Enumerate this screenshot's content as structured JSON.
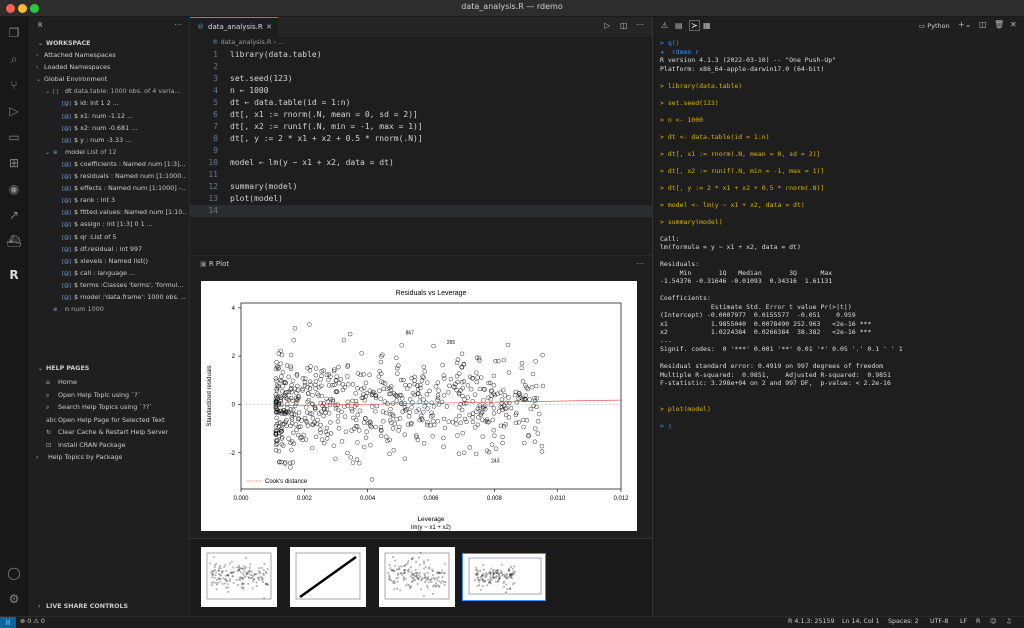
{
  "window": {
    "title": "data_analysis.R — rdemo"
  },
  "sidebar": {
    "title": "R",
    "workspace_header": "WORKSPACE",
    "items": [
      {
        "label": "Attached Namespaces",
        "indent": 0,
        "twist": "›"
      },
      {
        "label": "Loaded Namespaces",
        "indent": 0,
        "twist": "›"
      },
      {
        "label": "Global Environment",
        "indent": 0,
        "twist": "⌄"
      },
      {
        "label": "dt",
        "detail": "data.table: 1000 obs. of 4 varia...",
        "indent": 1,
        "twist": "⌄",
        "tag": "[ ]"
      },
      {
        "label": "$ id: int 1 2 ...",
        "indent": 2,
        "tag": "[@]"
      },
      {
        "label": "$ x1: num -1.12 ...",
        "indent": 2,
        "tag": "[@]"
      },
      {
        "label": "$ x2: num -0.681 ...",
        "indent": 2,
        "tag": "[@]"
      },
      {
        "label": "$ y : num -3.33 ...",
        "indent": 2,
        "tag": "[@]"
      },
      {
        "label": "model",
        "detail": "List of 12",
        "indent": 1,
        "twist": "⌄",
        "tag": "⊛"
      },
      {
        "label": "$ coefficients : Named num [1:3]...",
        "indent": 2,
        "tag": "[@]"
      },
      {
        "label": "$ residuals : Named num [1:1000...",
        "indent": 2,
        "tag": "[@]"
      },
      {
        "label": "$ effects : Named num [1:1000] -...",
        "indent": 2,
        "tag": "[@]"
      },
      {
        "label": "$ rank : int 3",
        "indent": 2,
        "tag": "[@]"
      },
      {
        "label": "$ fitted.values: Named num [1:10...",
        "indent": 2,
        "tag": "[@]"
      },
      {
        "label": "$ assign : int [1:3] 0 1 ...",
        "indent": 2,
        "tag": "[@]"
      },
      {
        "label": "$ qr :List of 5",
        "indent": 2,
        "tag": "[@]"
      },
      {
        "label": "$ df.residual : int 997",
        "indent": 2,
        "tag": "[@]"
      },
      {
        "label": "$ xlevels : Named list()",
        "indent": 2,
        "tag": "[@]"
      },
      {
        "label": "$ call : language ...",
        "indent": 2,
        "tag": "[@]"
      },
      {
        "label": "$ terms :Classes 'terms', 'formul...",
        "indent": 2,
        "tag": "[@]"
      },
      {
        "label": "$ model :'data.frame': 1000 obs. ...",
        "indent": 2,
        "tag": "[@]"
      },
      {
        "label": "n",
        "detail": "num 1000",
        "indent": 1,
        "tag": "⊛"
      }
    ],
    "help_header": "HELP PAGES",
    "help_items": [
      "Home",
      "Open Help Topic using `?`",
      "Search Help Topics using `??`",
      "Open Help Page for Selected Text",
      "Clear Cache & Restart Help Server",
      "Install CRAN Package",
      "Help Topics by Package"
    ],
    "help_icons": [
      "⌂",
      "⌕",
      "⌕",
      "abc",
      "↻",
      "⊡",
      "›"
    ],
    "liveshare": "LIVE SHARE CONTROLS"
  },
  "editor": {
    "tab": "data_analysis.R",
    "breadcrumb": "data_analysis.R › ...",
    "lines": [
      {
        "n": "1",
        "code": "library(data.table)"
      },
      {
        "n": "2",
        "code": ""
      },
      {
        "n": "3",
        "code": "set.seed(123)"
      },
      {
        "n": "4",
        "code": "n ← 1000"
      },
      {
        "n": "5",
        "code": "dt ← data.table(id = 1:n)"
      },
      {
        "n": "6",
        "code": "dt[, x1 := rnorm(.N, mean = 0, sd = 2)]"
      },
      {
        "n": "7",
        "code": "dt[, x2 := runif(.N, min = -1, max = 1)]"
      },
      {
        "n": "8",
        "code": "dt[, y := 2 * x1 + x2 + 0.5 * rnorm(.N)]"
      },
      {
        "n": "9",
        "code": ""
      },
      {
        "n": "10",
        "code": "model ← lm(y ~ x1 + x2, data = dt)"
      },
      {
        "n": "11",
        "code": ""
      },
      {
        "n": "12",
        "code": "summary(model)"
      },
      {
        "n": "13",
        "code": "plot(model)"
      },
      {
        "n": "14",
        "code": ""
      }
    ]
  },
  "plot": {
    "panel_title": "R Plot",
    "chart_data": {
      "type": "scatter",
      "title": "Residuals vs Leverage",
      "xlabel": "Leverage",
      "subtitle": "lm(y ~ x1 + x2)",
      "ylabel": "Standardized residuals",
      "xlim": [
        0,
        0.012
      ],
      "ylim": [
        -3.5,
        4.2
      ],
      "xticks": [
        "0.000",
        "0.002",
        "0.004",
        "0.006",
        "0.008",
        "0.010",
        "0.012"
      ],
      "yticks": [
        "-2",
        "0",
        "2",
        "4"
      ],
      "legend": "Cook's distance",
      "annotations": [
        {
          "text": "867",
          "x": 0.0052,
          "y": 2.9
        },
        {
          "text": "265",
          "x": 0.0065,
          "y": 2.5
        },
        {
          "text": "243",
          "x": 0.0079,
          "y": -2.4
        }
      ]
    }
  },
  "terminal": {
    "shell": "Python",
    "lines": [
      {
        "t": "> q()",
        "c": "pr"
      },
      {
        "t": "◂  rdemo r",
        "c": "pr"
      },
      {
        "t": "R version 4.1.3 (2022-03-10) -- \"One Push-Up\"",
        "c": ""
      },
      {
        "t": "Platform: x86_64-apple-darwin17.0 (64-bit)",
        "c": ""
      },
      {
        "t": "",
        "c": ""
      },
      {
        "t": "> library(data.table)",
        "c": "cmd"
      },
      {
        "t": "",
        "c": ""
      },
      {
        "t": "> set.seed(123)",
        "c": "cmd"
      },
      {
        "t": "",
        "c": ""
      },
      {
        "t": "> n <- 1000",
        "c": "cmd"
      },
      {
        "t": "",
        "c": ""
      },
      {
        "t": "> dt <- data.table(id = 1:n)",
        "c": "cmd"
      },
      {
        "t": "",
        "c": ""
      },
      {
        "t": "> dt[, x1 := rnorm(.N, mean = 0, sd = 2)]",
        "c": "cmd"
      },
      {
        "t": "",
        "c": ""
      },
      {
        "t": "> dt[, x2 := runif(.N, min = -1, max = 1)]",
        "c": "cmd"
      },
      {
        "t": "",
        "c": ""
      },
      {
        "t": "> dt[, y := 2 * x1 + x2 + 0.5 * rnorm(.N)]",
        "c": "cmd"
      },
      {
        "t": "",
        "c": ""
      },
      {
        "t": "> model <- lm(y ~ x1 + x2, data = dt)",
        "c": "cmd"
      },
      {
        "t": "",
        "c": ""
      },
      {
        "t": "> summary(model)",
        "c": "cmd"
      },
      {
        "t": "",
        "c": ""
      },
      {
        "t": "Call:",
        "c": ""
      },
      {
        "t": "lm(formula = y ~ x1 + x2, data = dt)",
        "c": ""
      },
      {
        "t": "",
        "c": ""
      },
      {
        "t": "Residuals:",
        "c": ""
      },
      {
        "t": "     Min       1Q   Median       3Q      Max",
        "c": ""
      },
      {
        "t": "-1.54376 -0.31646 -0.01093  0.34316  1.61131",
        "c": ""
      },
      {
        "t": "",
        "c": ""
      },
      {
        "t": "Coefficients:",
        "c": ""
      },
      {
        "t": "             Estimate Std. Error t value Pr(>|t|)",
        "c": ""
      },
      {
        "t": "(Intercept) -0.0007977  0.0155577  -0.051    0.959",
        "c": ""
      },
      {
        "t": "x1           1.9855040  0.0078490 252.963   <2e-16 ***",
        "c": ""
      },
      {
        "t": "x2           1.0224384  0.0266384  38.382   <2e-16 ***",
        "c": ""
      },
      {
        "t": "---",
        "c": ""
      },
      {
        "t": "Signif. codes:  0 '***' 0.001 '**' 0.01 '*' 0.05 '.' 0.1 ' ' 1",
        "c": ""
      },
      {
        "t": "",
        "c": ""
      },
      {
        "t": "Residual standard error: 0.4919 on 997 degrees of freedom",
        "c": ""
      },
      {
        "t": "Multiple R-squared:  0.9851,\tAdjusted R-squared:  0.9851",
        "c": ""
      },
      {
        "t": "F-statistic: 3.298e+04 on 2 and 997 DF,  p-value: < 2.2e-16",
        "c": ""
      },
      {
        "t": "",
        "c": ""
      },
      {
        "t": "",
        "c": ""
      },
      {
        "t": "> plot(model)",
        "c": "cmd"
      },
      {
        "t": "",
        "c": ""
      },
      {
        "t": "> ▯",
        "c": "pr"
      }
    ]
  },
  "status": {
    "problems": "⊗ 0 ⚠ 0",
    "rver": "R 4.1.3: 25159",
    "pos": "Ln 14, Col 1",
    "spaces": "Spaces: 2",
    "enc": "UTF-8",
    "eol": "LF",
    "lang": "R"
  }
}
